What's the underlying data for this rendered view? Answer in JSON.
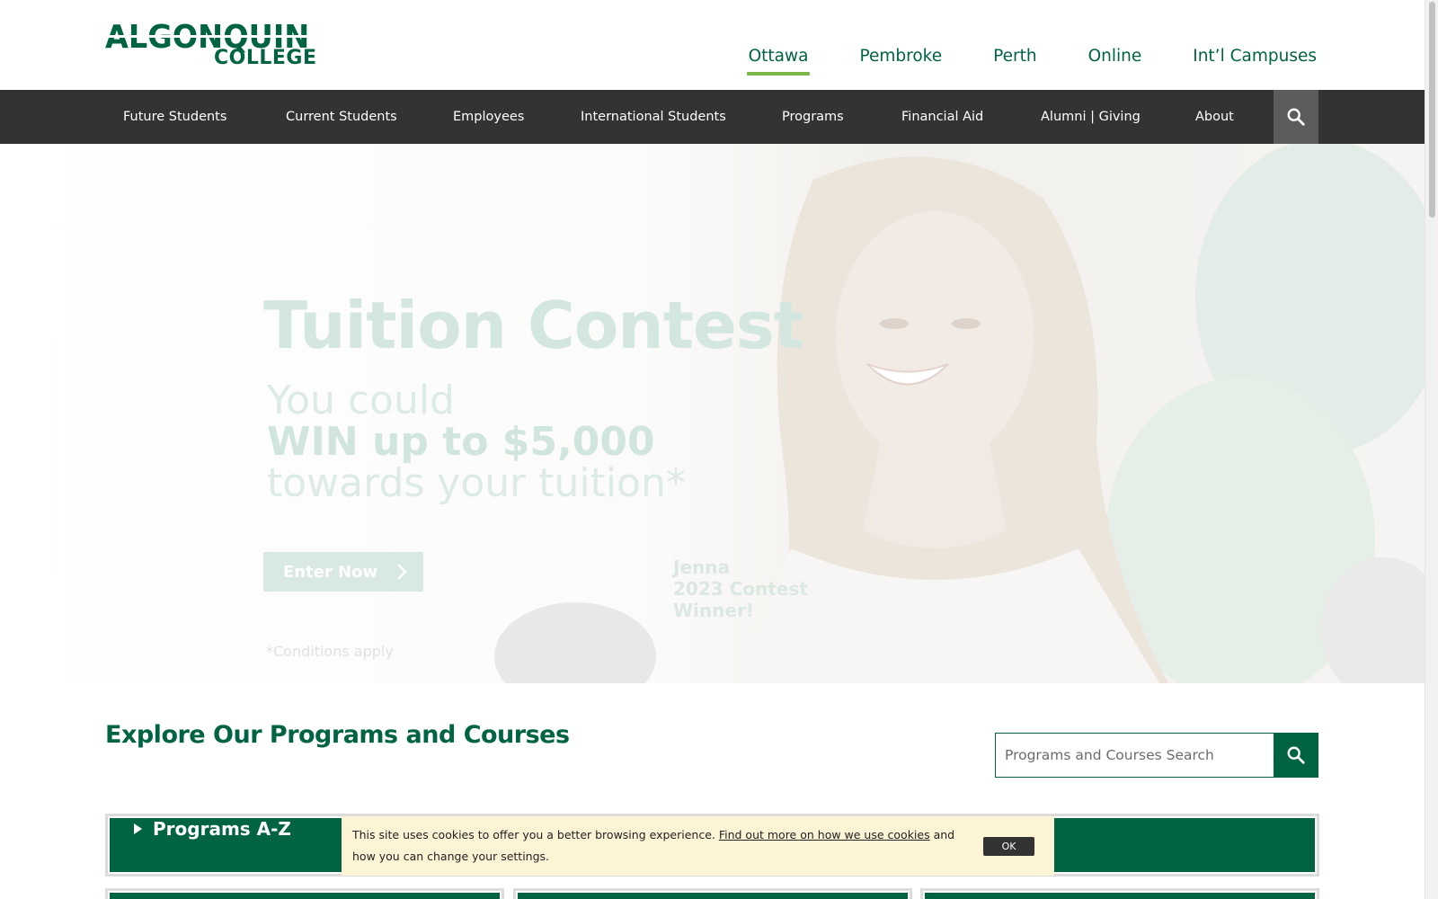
{
  "logo": {
    "line1": "ALGONQUIN",
    "line2": "COLLEGE"
  },
  "campus_nav": [
    {
      "label": "Ottawa",
      "active": true
    },
    {
      "label": "Pembroke",
      "active": false
    },
    {
      "label": "Perth",
      "active": false
    },
    {
      "label": "Online",
      "active": false
    },
    {
      "label": "Int’l Campuses",
      "active": false
    }
  ],
  "main_nav": [
    "Future Students",
    "Current Students",
    "Employees",
    "International Students",
    "Programs",
    "Financial Aid",
    "Alumni | Giving",
    "About"
  ],
  "hero": {
    "title": "Tuition Contest",
    "line1": "You could",
    "line2": "WIN up to $5,000",
    "line3": "towards your tuition*",
    "cta": "Enter Now",
    "caption": [
      "Jenna",
      "2023 Contest",
      "Winner!"
    ],
    "conditions": "*Conditions apply"
  },
  "explore": {
    "title": "Explore Our Programs and Courses",
    "search_placeholder": "Programs and Courses Search"
  },
  "accordion": {
    "label": "Programs A-Z"
  },
  "cookie": {
    "text_before": "This site uses cookies to offer you a better browsing experience. ",
    "link": "Find out more on how we use cookies",
    "text_after": " and how you can change your settings.",
    "ok": "OK"
  },
  "colors": {
    "brand_green": "#006341",
    "accent_green": "#7ab648",
    "nav_bg": "#333333",
    "cookie_bg": "#fdf3d5"
  },
  "icons": [
    "search-icon",
    "chevron-right-icon",
    "triangle-right-icon"
  ]
}
